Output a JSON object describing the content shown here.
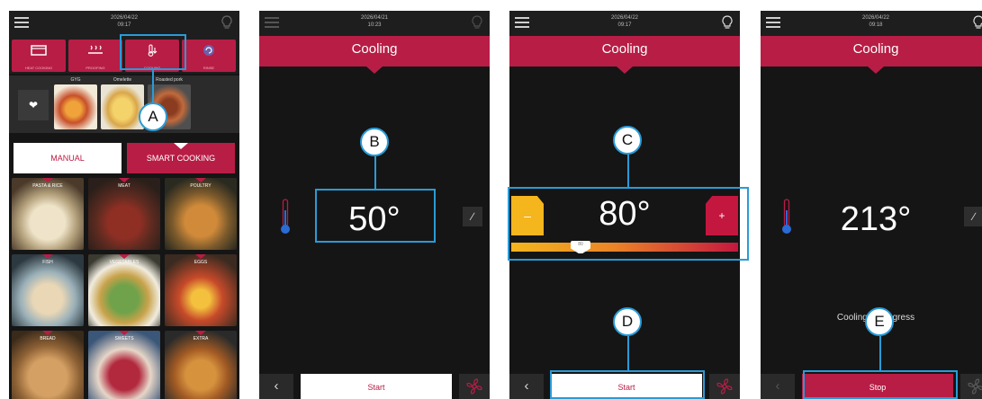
{
  "colors": {
    "brand": "#b81d45",
    "screen_bg": "#151515",
    "callout": "#2a9bd7",
    "min_color": "#f4b51d"
  },
  "screen1": {
    "date": "2026/04/22",
    "time": "09:17",
    "modes": [
      {
        "label": "HEAT COOKING"
      },
      {
        "label": "PROOFING"
      },
      {
        "label": "COOLING"
      },
      {
        "label": "RINSE"
      }
    ],
    "favorites": [
      "GYG",
      "Omelette",
      "Roasted pork"
    ],
    "manual_label": "MANUAL",
    "smart_label": "SMART COOKING",
    "categories": [
      "PASTA & RICE",
      "MEAT",
      "POULTRY",
      "FISH",
      "VEGETABLES",
      "EGGS",
      "BREAD",
      "SWEETS",
      "EXTRA"
    ]
  },
  "screen2": {
    "date": "2026/04/21",
    "time": "10:23",
    "title": "Cooling",
    "temp": "50°",
    "action": "Start"
  },
  "screen3": {
    "date": "2026/04/22",
    "time": "09:17",
    "title": "Cooling",
    "temp": "80°",
    "minus": "–",
    "plus": "+",
    "slider_label": "80",
    "action": "Start"
  },
  "screen4": {
    "date": "2026/04/22",
    "time": "09:18",
    "title": "Cooling",
    "temp": "213°",
    "progress": "Cooling in progress",
    "action": "Stop"
  },
  "callouts": {
    "a": "A",
    "b": "B",
    "c": "C",
    "d": "D",
    "e": "E"
  }
}
